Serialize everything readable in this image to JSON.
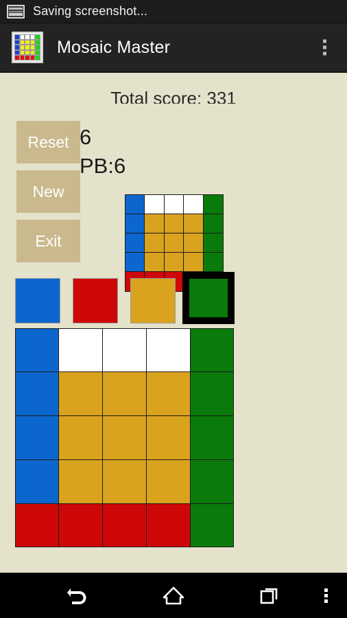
{
  "status_bar": {
    "icon": "screenshot-image-icon",
    "text": "Saving screenshot..."
  },
  "action_bar": {
    "app_icon": "mosaic-grid-icon",
    "title": "Mosaic Master",
    "overflow_icon": "overflow-menu-icon"
  },
  "game": {
    "total_score_label": "Total score: 331",
    "move_count": "6",
    "personal_best_label": "PB:6",
    "buttons": [
      {
        "label": "Reset",
        "name": "reset-button"
      },
      {
        "label": "New",
        "name": "new-button"
      },
      {
        "label": "Exit",
        "name": "exit-button"
      }
    ],
    "colors": {
      "background": "#e4e2ca",
      "button": "#c9b98d",
      "blue": "#0b67ce",
      "red": "#ce0808",
      "gold": "#d9a31e",
      "green": "#0a7a0a",
      "white": "#ffffff",
      "selection_border": "#000000",
      "cell_border": "#1a1a1a"
    },
    "palette": {
      "swatches": [
        "blue",
        "red",
        "gold",
        "green"
      ],
      "selected_index": 3
    },
    "target_grid": {
      "rows": 5,
      "cols": 5,
      "cells": [
        [
          "blue",
          "white",
          "white",
          "white",
          "green"
        ],
        [
          "blue",
          "gold",
          "gold",
          "gold",
          "green"
        ],
        [
          "blue",
          "gold",
          "gold",
          "gold",
          "green"
        ],
        [
          "blue",
          "gold",
          "gold",
          "gold",
          "green"
        ],
        [
          "red",
          "red",
          "red",
          "red",
          "green"
        ]
      ]
    },
    "board_grid": {
      "rows": 5,
      "cols": 5,
      "cells": [
        [
          "blue",
          "white",
          "white",
          "white",
          "green"
        ],
        [
          "blue",
          "gold",
          "gold",
          "gold",
          "green"
        ],
        [
          "blue",
          "gold",
          "gold",
          "gold",
          "green"
        ],
        [
          "blue",
          "gold",
          "gold",
          "gold",
          "green"
        ],
        [
          "red",
          "red",
          "red",
          "red",
          "green"
        ]
      ]
    },
    "app_icon_cells": [
      [
        "blue",
        "white",
        "white",
        "white",
        "green"
      ],
      [
        "blue",
        "yellow",
        "yellow",
        "yellow",
        "green"
      ],
      [
        "blue",
        "yellow",
        "yellow",
        "yellow",
        "green"
      ],
      [
        "blue",
        "yellow",
        "yellow",
        "yellow",
        "green"
      ],
      [
        "red",
        "red",
        "red",
        "red",
        "green"
      ]
    ],
    "app_icon_colors": {
      "blue": "#1b3fd6",
      "white": "#ffffff",
      "green": "#19d619",
      "yellow": "#f2ee1c",
      "red": "#e01010"
    }
  },
  "nav_bar": {
    "back": "back-icon",
    "home": "home-icon",
    "recents": "recents-icon",
    "more": "overflow-menu-icon"
  }
}
